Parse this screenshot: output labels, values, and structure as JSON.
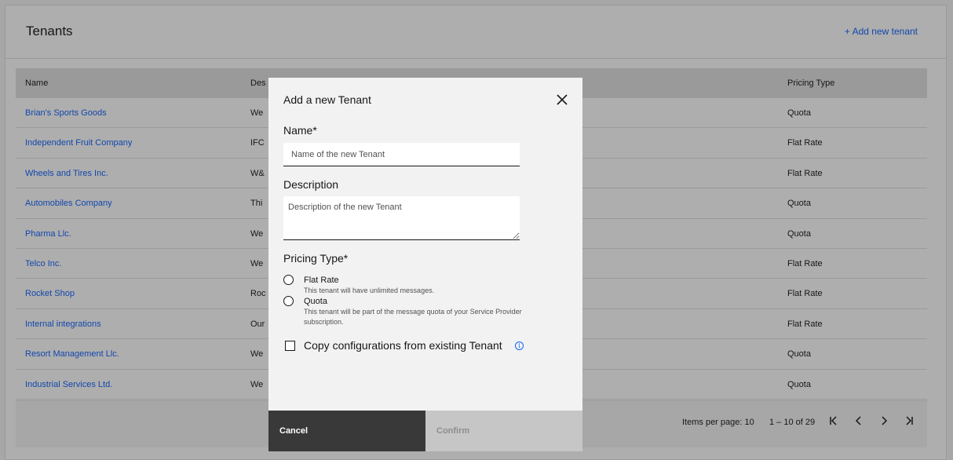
{
  "header": {
    "title": "Tenants",
    "add_link": "+ Add new tenant"
  },
  "table": {
    "columns": [
      "Name",
      "Des",
      "Pricing Type"
    ],
    "rows": [
      {
        "name": "Brian's Sports Goods",
        "desc": "We",
        "ptype": "Quota"
      },
      {
        "name": "Independent Fruit Company",
        "desc": "IFC",
        "ptype": "Flat Rate"
      },
      {
        "name": "Wheels and Tires Inc.",
        "desc": "W&",
        "ptype": "Flat Rate"
      },
      {
        "name": "Automobiles Company",
        "desc": "Thi",
        "ptype": "Quota"
      },
      {
        "name": "Pharma Llc.",
        "desc": "We",
        "ptype": "Quota"
      },
      {
        "name": "Telco Inc.",
        "desc": "We",
        "ptype": "Flat Rate"
      },
      {
        "name": "Rocket Shop",
        "desc": "Roc",
        "ptype": "Flat Rate"
      },
      {
        "name": "Internal integrations",
        "desc": "Our",
        "ptype": "Flat Rate"
      },
      {
        "name": "Resort Management Llc.",
        "desc": "We",
        "ptype": "Quota"
      },
      {
        "name": "Industrial Services Ltd.",
        "desc": "We",
        "ptype": "Quota"
      }
    ]
  },
  "pagination": {
    "items_per_page": "Items per page: 10",
    "range": "1 – 10 of 29",
    "first_icon": "first-page-icon",
    "prev_icon": "chevron-left-icon",
    "next_icon": "chevron-right-icon",
    "last_icon": "last-page-icon"
  },
  "modal": {
    "title": "Add a new Tenant",
    "close_icon": "close-icon",
    "name_label": "Name*",
    "name_placeholder": "Name of the new Tenant",
    "description_label": "Description",
    "description_placeholder": "Description of the new Tenant",
    "pricing_label": "Pricing Type*",
    "options": [
      {
        "label": "Flat Rate",
        "help": "This tenant will have unlimited messages."
      },
      {
        "label": "Quota",
        "help": "This tenant will be part of the message quota of your Service Provider subscription."
      }
    ],
    "copy_label": "Copy configurations from existing Tenant",
    "info_icon": "info-icon",
    "cancel_label": "Cancel",
    "confirm_label": "Confirm"
  },
  "colors": {
    "link": "#0f62fe",
    "cancel_bg": "#393939",
    "confirm_bg": "#c6c6c6"
  }
}
